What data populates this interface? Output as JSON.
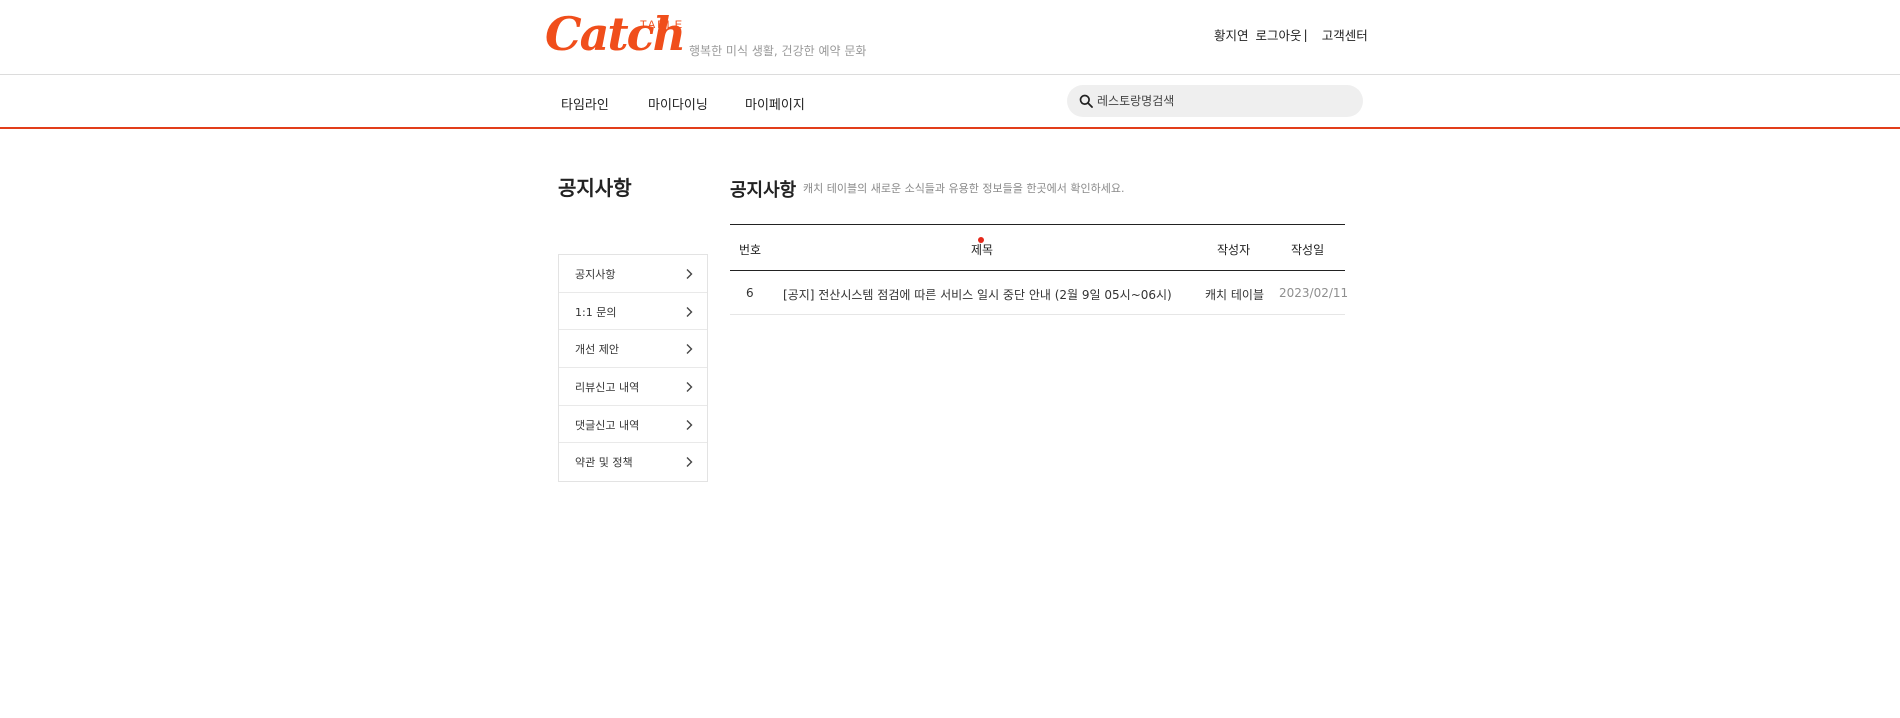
{
  "header": {
    "logo_main": "Catch",
    "logo_sub": "TABLE",
    "tagline": "행복한 미식 생활, 건강한 예약 문화",
    "user_name": "황지연",
    "logout_label": "로그아웃",
    "separator": "|",
    "support_label": "고객센터"
  },
  "nav": {
    "items": [
      {
        "label": "타임라인"
      },
      {
        "label": "마이다이닝"
      },
      {
        "label": "마이페이지"
      }
    ],
    "search": {
      "placeholder": "레스토랑명검색",
      "icon": "search-icon"
    }
  },
  "sidebar": {
    "title": "공지사항",
    "items": [
      {
        "label": "공지사항"
      },
      {
        "label": "1:1 문의"
      },
      {
        "label": "개선 제안"
      },
      {
        "label": "리뷰신고 내역"
      },
      {
        "label": "댓글신고 내역"
      },
      {
        "label": "약관 및 정책"
      }
    ],
    "item_icon": "chevron-right-icon"
  },
  "main": {
    "title": "공지사항",
    "description": "캐치 테이블의 새로운 소식들과 유용한 정보들을 한곳에서 확인하세요.",
    "table": {
      "columns": [
        "번호",
        "제목",
        "작성자",
        "작성일"
      ],
      "rows": [
        {
          "no": "6",
          "title": "[공지] 전산시스템 점검에 따른 서비스 일시 중단 안내 (2월 9일 05시~06시)",
          "author": "캐치 테이블",
          "date": "2023/02/11"
        }
      ]
    }
  },
  "colors": {
    "brand": "#f04e1b",
    "nav_underline": "#e23e1a",
    "cursor_dot": "#e5281a"
  }
}
